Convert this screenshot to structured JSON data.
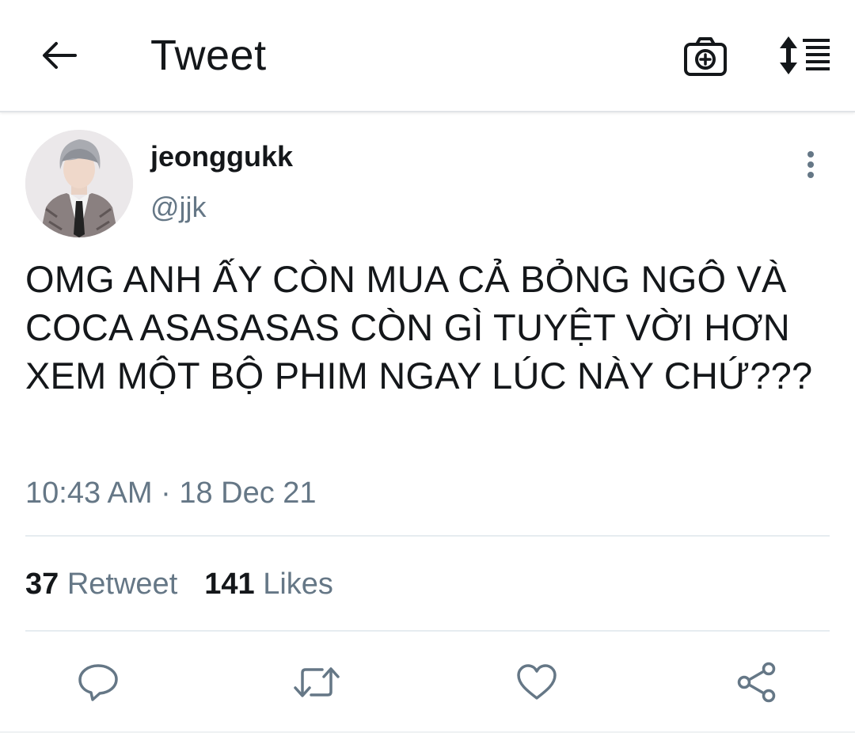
{
  "header": {
    "title": "Tweet",
    "back_icon": "back-arrow-icon",
    "camera_icon": "camera-add-icon",
    "sort_icon": "sort-list-icon"
  },
  "tweet": {
    "display_name": "jeonggukk",
    "handle": "@jjk",
    "text": "OMG ANH ẤY CÒN MUA CẢ BỎNG NGÔ VÀ COCA ASASASAS CÒN GÌ TUYỆT VỜI HƠN XEM MỘT BỘ PHIM NGAY LÚC NÀY CHỨ???",
    "timestamp": "10:43 AM · 18 Dec 21"
  },
  "stats": {
    "retweets_count": "37",
    "retweets_label": "Retweet",
    "likes_count": "141",
    "likes_label": "Likes"
  },
  "colors": {
    "text_primary": "#14171a",
    "text_secondary": "#657786",
    "icon": "#657786",
    "divider": "#e6ecf0"
  }
}
